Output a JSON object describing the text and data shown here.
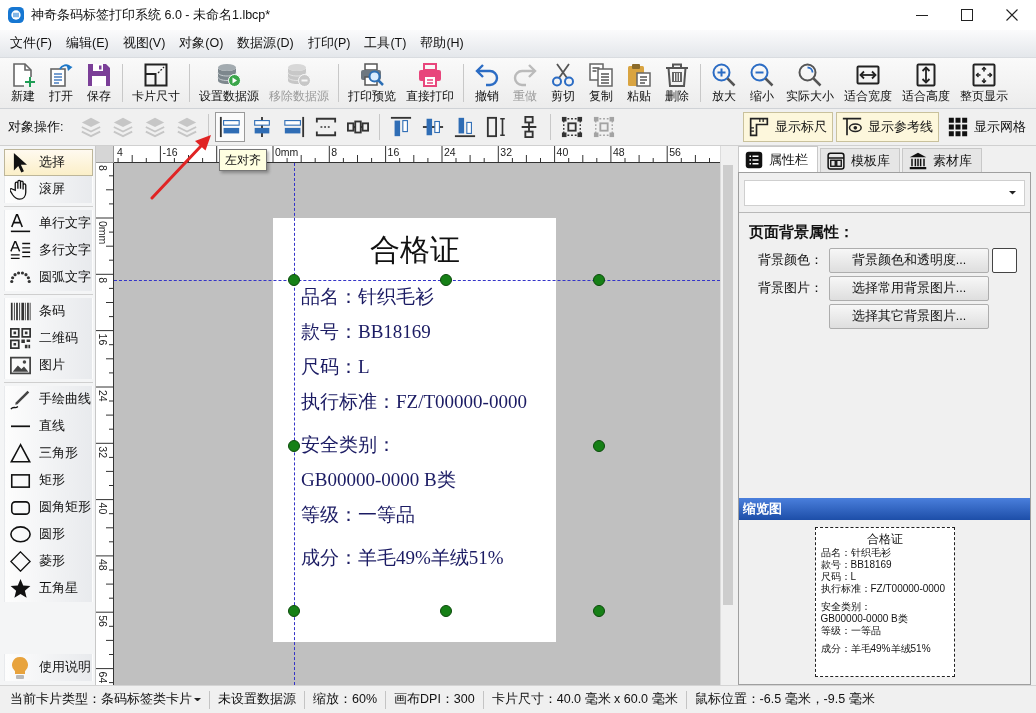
{
  "window": {
    "title": "神奇条码标签打印系统 6.0 - 未命名1.lbcp*"
  },
  "menu": [
    "文件(F)",
    "编辑(E)",
    "视图(V)",
    "对象(O)",
    "数据源(D)",
    "打印(P)",
    "工具(T)",
    "帮助(H)"
  ],
  "toolbar": [
    [
      {
        "label": "新建",
        "disabled": false
      },
      {
        "label": "打开",
        "disabled": false
      },
      {
        "label": "保存",
        "disabled": false
      }
    ],
    [
      {
        "label": "卡片尺寸",
        "disabled": false
      }
    ],
    [
      {
        "label": "设置数据源",
        "disabled": false
      },
      {
        "label": "移除数据源",
        "disabled": true
      }
    ],
    [
      {
        "label": "打印预览",
        "disabled": false
      },
      {
        "label": "直接打印",
        "disabled": false
      }
    ],
    [
      {
        "label": "撤销",
        "disabled": false
      },
      {
        "label": "重做",
        "disabled": true
      },
      {
        "label": "剪切",
        "disabled": false
      },
      {
        "label": "复制",
        "disabled": false
      },
      {
        "label": "粘贴",
        "disabled": false
      },
      {
        "label": "删除",
        "disabled": false
      }
    ],
    [
      {
        "label": "放大",
        "disabled": false
      },
      {
        "label": "缩小",
        "disabled": false
      },
      {
        "label": "实际大小",
        "disabled": false
      },
      {
        "label": "适合宽度",
        "disabled": false
      },
      {
        "label": "适合高度",
        "disabled": false
      },
      {
        "label": "整页显示",
        "disabled": false
      }
    ]
  ],
  "object_toolbar": {
    "label": "对象操作:",
    "groups": [
      [
        {
          "disabled": true,
          "pressed": false
        },
        {
          "disabled": true,
          "pressed": false
        },
        {
          "disabled": true,
          "pressed": false
        },
        {
          "disabled": true,
          "pressed": false
        }
      ],
      [
        {
          "disabled": false,
          "pressed": true
        },
        {
          "disabled": false,
          "pressed": false
        },
        {
          "disabled": false,
          "pressed": false
        },
        {
          "disabled": false,
          "pressed": false
        },
        {
          "disabled": false,
          "pressed": false
        }
      ],
      [
        {
          "disabled": false,
          "pressed": false
        },
        {
          "disabled": false,
          "pressed": false
        },
        {
          "disabled": false,
          "pressed": false
        },
        {
          "disabled": false,
          "pressed": false
        },
        {
          "disabled": false,
          "pressed": false
        }
      ],
      [
        {
          "disabled": false,
          "pressed": false
        },
        {
          "disabled": true,
          "pressed": false
        }
      ]
    ],
    "tooltip": "左对齐",
    "toggles": [
      {
        "label": "显示标尺",
        "on": true
      },
      {
        "label": "显示参考线",
        "on": true
      },
      {
        "label": "显示网格",
        "on": false
      }
    ]
  },
  "tools": {
    "groups": [
      [
        {
          "label": "选择",
          "selected": true
        },
        {
          "label": "滚屏",
          "selected": false
        }
      ],
      [
        {
          "label": "单行文字",
          "selected": false
        },
        {
          "label": "多行文字",
          "selected": false
        },
        {
          "label": "圆弧文字",
          "selected": false
        }
      ],
      [
        {
          "label": "条码",
          "selected": false
        },
        {
          "label": "二维码",
          "selected": false
        },
        {
          "label": "图片",
          "selected": false
        }
      ],
      [
        {
          "label": "手绘曲线",
          "selected": false
        },
        {
          "label": "直线",
          "selected": false
        },
        {
          "label": "三角形",
          "selected": false
        },
        {
          "label": "矩形",
          "selected": false
        },
        {
          "label": "圆角矩形",
          "selected": false
        },
        {
          "label": "圆形",
          "selected": false
        },
        {
          "label": "菱形",
          "selected": false
        },
        {
          "label": "五角星",
          "selected": false
        }
      ]
    ],
    "help": "使用说明"
  },
  "rulers": {
    "horizontal": [
      "4",
      "-16",
      "0mm",
      "8",
      "16",
      "24",
      "32",
      "40",
      "48",
      "56"
    ],
    "vertical": [
      "8",
      "0mm",
      "8",
      "16",
      "24",
      "32",
      "40",
      "48",
      "56",
      "64"
    ]
  },
  "card": {
    "title": "合格证",
    "blocks": [
      [
        "品名：针织毛衫",
        "款号：BB18169",
        "尺码：L",
        "执行标准：FZ/T00000-0000"
      ],
      [
        "安全类别：",
        "GB00000-0000 B类",
        "等级：一等品"
      ],
      [
        "成分：羊毛49%羊绒51%"
      ]
    ]
  },
  "side_panel": {
    "tabs": [
      {
        "label": "属性栏",
        "selected": true
      },
      {
        "label": "模板库",
        "selected": false
      },
      {
        "label": "素材库",
        "selected": false
      }
    ],
    "heading": "页面背景属性：",
    "color_label": "背景颜色：",
    "color_button": "背景颜色和透明度...",
    "color": "#ffffff",
    "image_label": "背景图片：",
    "image_buttons": [
      "选择常用背景图片...",
      "选择其它背景图片..."
    ]
  },
  "thumbnail": {
    "title": "缩览图",
    "card_title": "合格证",
    "blocks": [
      [
        "品名：针织毛衫",
        "款号：BB18169",
        "尺码：L",
        "执行标准：FZ/T00000-0000"
      ],
      [
        "安全类别：",
        "GB00000-0000 B类",
        "等级：一等品"
      ],
      [
        "成分：羊毛49%羊绒51%"
      ]
    ]
  },
  "status_bar": [
    {
      "text": "当前卡片类型：条码标签类卡片",
      "kind": "dropdown"
    },
    {
      "text": "未设置数据源",
      "kind": "plain"
    },
    {
      "text": "缩放：60%",
      "kind": "plain"
    },
    {
      "text": "画布DPI：300",
      "kind": "plain"
    },
    {
      "text": "卡片尺寸：40.0 毫米 x 60.0 毫米",
      "kind": "plain"
    },
    {
      "text": "鼠标位置：-6.5 毫米，-9.5 毫米",
      "kind": "plain"
    }
  ]
}
